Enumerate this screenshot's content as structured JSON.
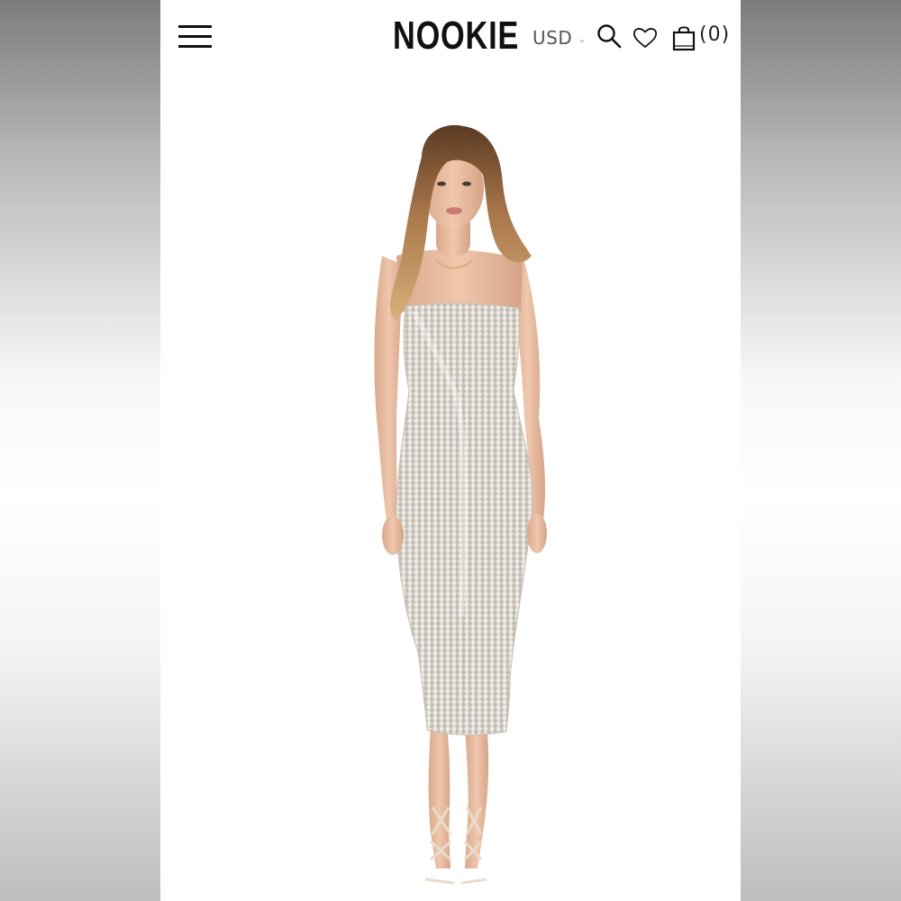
{
  "header": {
    "menu_icon": "hamburger-menu-icon",
    "logo": "NOOKIE",
    "currency": {
      "selected": "USD",
      "icon": "chevron-down-icon"
    },
    "search_icon": "search-icon",
    "wishlist_icon": "heart-icon",
    "cart": {
      "icon": "shopping-bag-icon",
      "count": "(0)"
    }
  },
  "product": {
    "image": "model-wearing-strapless-silver-sequin-midi-dress"
  },
  "colors": {
    "text": "#111111",
    "background": "#ffffff",
    "sequin": "#d9d4cc"
  }
}
